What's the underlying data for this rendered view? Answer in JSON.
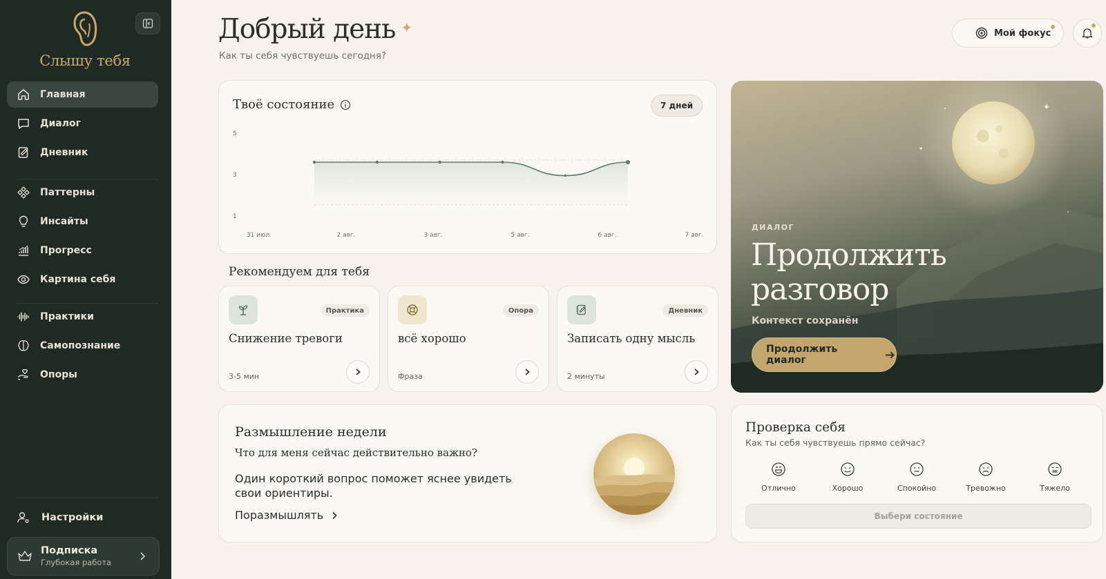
{
  "brand": {
    "name": "Слышу тебя"
  },
  "sidebar": {
    "items": [
      {
        "label": "Главная",
        "icon": "home-icon",
        "active": true
      },
      {
        "label": "Диалог",
        "icon": "chat-icon"
      },
      {
        "label": "Дневник",
        "icon": "journal-icon"
      },
      {
        "label": "Паттерны",
        "icon": "patterns-icon"
      },
      {
        "label": "Инсайты",
        "icon": "lightbulb-icon"
      },
      {
        "label": "Прогресс",
        "icon": "progress-chart-icon"
      },
      {
        "label": "Картина себя",
        "icon": "eye-icon"
      },
      {
        "label": "Практики",
        "icon": "waveform-icon"
      },
      {
        "label": "Самопознание",
        "icon": "brain-icon"
      },
      {
        "label": "Опоры",
        "icon": "support-hand-icon"
      }
    ],
    "settings_label": "Настройки",
    "subscription": {
      "title": "Подписка",
      "desc": "Глубокая работа"
    }
  },
  "header": {
    "greeting": "Добрый день",
    "subtitle": "Как ты себя чувствуешь сегодня?",
    "focus_label": "Мой фокус"
  },
  "state_card": {
    "title": "Твоё состояние",
    "range_chip": "7 дней",
    "chart_data": {
      "type": "area",
      "x": [
        "31 июл.",
        "2 авг.",
        "3 авг.",
        "5 авг.",
        "6 авг.",
        "7 авг."
      ],
      "y_ticks": [
        "5",
        "3",
        "1"
      ],
      "ylim": [
        1,
        5
      ],
      "series": [
        {
          "values": [
            3.6,
            3.6,
            3.6,
            3.6,
            2.95,
            3.6
          ]
        }
      ],
      "grid": false
    },
    "accent_color": "#5e7b68"
  },
  "recommend": {
    "title": "Рекомендуем для тебя",
    "cards": [
      {
        "tag": "Практика",
        "name": "Снижение тревоги",
        "meta": "3-5 мин",
        "icon": "sprout-icon",
        "icon_bg": "#dfe4da"
      },
      {
        "tag": "Опора",
        "name": "всё хорошо",
        "meta": "Фраза",
        "icon": "lifebuoy-icon",
        "icon_bg": "#f1e6cf"
      },
      {
        "tag": "Дневник",
        "name": "Записать одну мысль",
        "meta": "2 минуты",
        "icon": "journal-edit-icon",
        "icon_bg": "#dfe4da"
      }
    ]
  },
  "reflection": {
    "title": "Размышление недели",
    "question": "Что для меня сейчас действительно важно?",
    "text": "Один короткий вопрос поможет яснее увидеть свои ориентиры.",
    "link": "Поразмышлять"
  },
  "hero": {
    "kicker": "ДИАЛОГ",
    "title_line1": "Продолжить",
    "title_line2": "разговор",
    "subtitle": "Контекст сохранён",
    "button": "Продолжить диалог"
  },
  "check": {
    "title": "Проверка себя",
    "subtitle": "Как ты себя чувствуешь прямо сейчас?",
    "moods": [
      "Отлично",
      "Хорошо",
      "Спокойно",
      "Тревожно",
      "Тяжело"
    ],
    "button": "Выбери состояние"
  },
  "colors": {
    "sidebar_bg": "#1f2a25",
    "gold": "#c9a96a",
    "page_bg": "#f7f3ec"
  }
}
